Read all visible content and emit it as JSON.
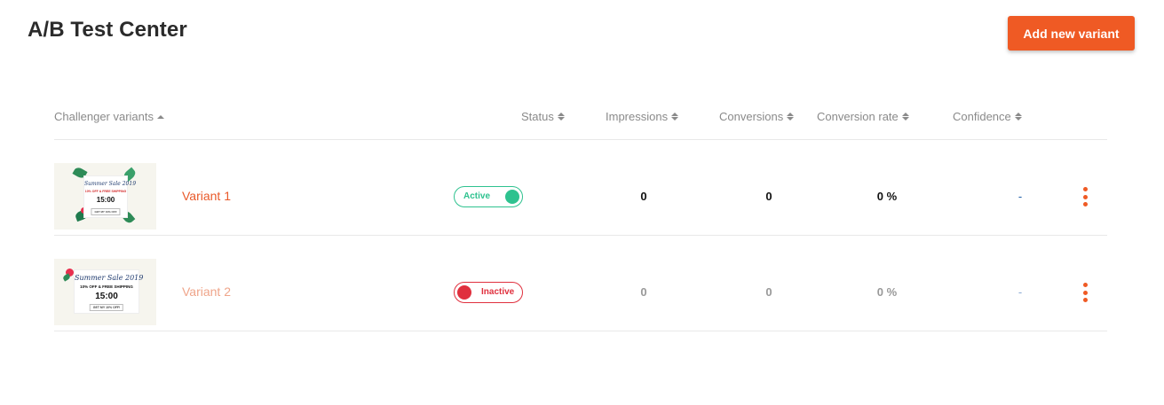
{
  "page": {
    "title": "A/B Test Center",
    "add_button_label": "Add new variant"
  },
  "table": {
    "columns": [
      {
        "label": "Challenger variants",
        "sort": "asc"
      },
      {
        "label": "Status",
        "sort": "both"
      },
      {
        "label": "Impressions",
        "sort": "both"
      },
      {
        "label": "Conversions",
        "sort": "both"
      },
      {
        "label": "Conversion rate",
        "sort": "both"
      },
      {
        "label": "Confidence",
        "sort": "both"
      }
    ],
    "rows": [
      {
        "name": "Variant 1",
        "status": "Active",
        "impressions": "0",
        "conversions": "0",
        "conversion_rate": "0 %",
        "confidence": "-",
        "thumbnail": {
          "script": "Summer Sale 2019",
          "offer": "10% OFF & FREE SHIPPING",
          "timer": "15:00",
          "cta": "GET MY 10% OFF"
        }
      },
      {
        "name": "Variant 2",
        "status": "Inactive",
        "impressions": "0",
        "conversions": "0",
        "conversion_rate": "0 %",
        "confidence": "-",
        "thumbnail": {
          "script": "Summer Sale 2019",
          "offer": "10% OFF & FREE SHIPPING",
          "timer": "15:00",
          "cta": "GET MY 10% OFF!"
        }
      }
    ]
  },
  "colors": {
    "accent": "#ef5a24",
    "active": "#2ec28f",
    "inactive": "#e0303e"
  },
  "icons": {
    "sort": "sort-arrows-icon",
    "menu": "kebab-menu-icon"
  }
}
